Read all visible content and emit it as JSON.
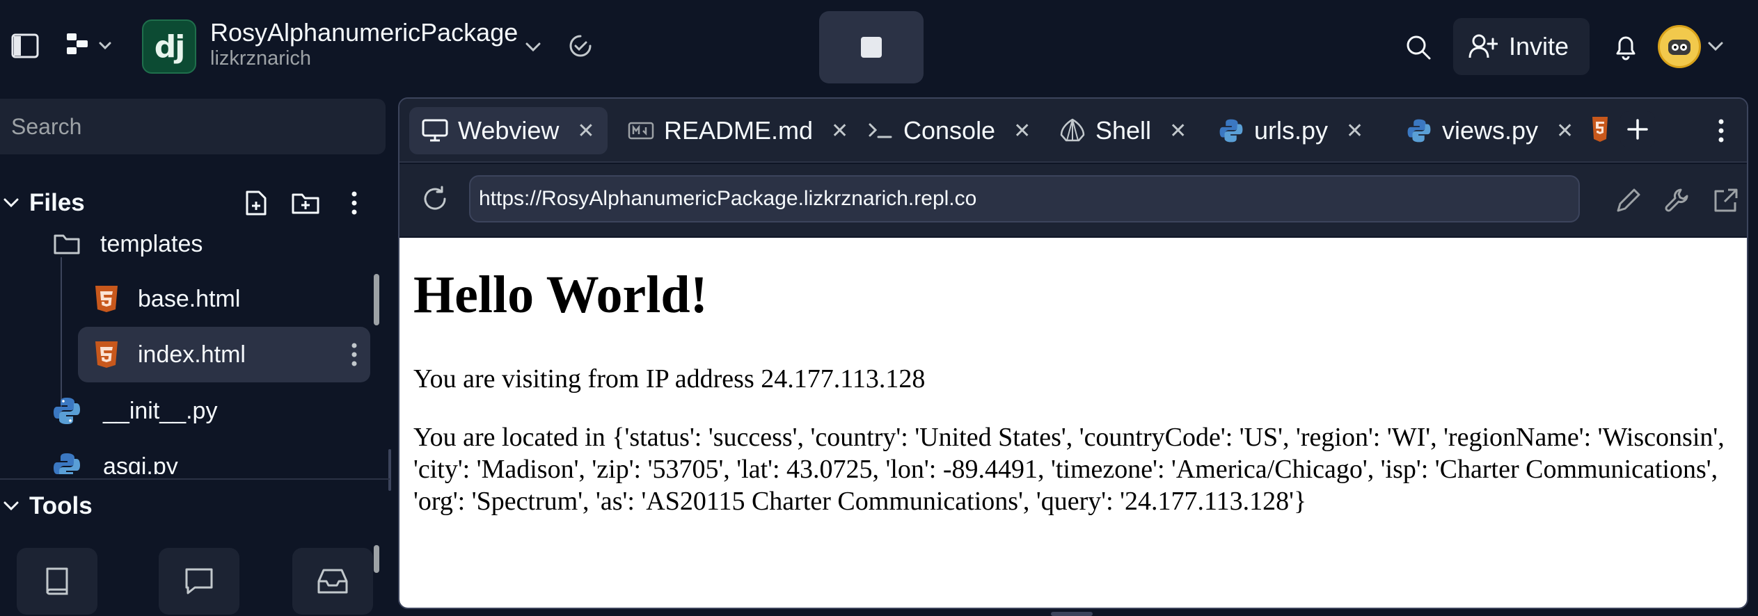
{
  "header": {
    "project_name": "RosyAlphanumericPackage",
    "project_owner": "lizkrznarich",
    "logo_text": "dj",
    "invite_label": "Invite",
    "accent_logo_bg": "#0c4b33"
  },
  "sidebar": {
    "search_placeholder": "Search",
    "files_label": "Files",
    "tools_label": "Tools",
    "tree": [
      {
        "label": "templates",
        "icon": "folder-icon"
      },
      {
        "label": "base.html",
        "icon": "html5-icon"
      },
      {
        "label": "index.html",
        "icon": "html5-icon",
        "selected": true
      },
      {
        "label": "__init__.py",
        "icon": "python-icon"
      },
      {
        "label": "asgi.py",
        "icon": "python-icon"
      }
    ],
    "tools": [
      "book-icon",
      "chat-icon",
      "inbox-icon"
    ]
  },
  "tabs": [
    {
      "label": "Webview",
      "icon": "monitor-icon",
      "active": true
    },
    {
      "label": "README.md",
      "icon": "markdown-icon"
    },
    {
      "label": "Console",
      "icon": "terminal-icon"
    },
    {
      "label": "Shell",
      "icon": "shell-icon"
    },
    {
      "label": "urls.py",
      "icon": "python-icon"
    },
    {
      "label": "views.py",
      "icon": "python-icon"
    }
  ],
  "webview": {
    "url": "https://RosyAlphanumericPackage.lizkrznarich.repl.co",
    "heading": "Hello World!",
    "ip_line": "You are visiting from IP address 24.177.113.128",
    "location_line": "You are located in {'status': 'success', 'country': 'United States', 'countryCode': 'US', 'region': 'WI', 'regionName': 'Wisconsin', 'city': 'Madison', 'zip': '53705', 'lat': 43.0725, 'lon': -89.4491, 'timezone': 'America/Chicago', 'isp': 'Charter Communications', 'org': 'Spectrum', 'as': 'AS20115 Charter Communications', 'query': '24.177.113.128'}"
  }
}
